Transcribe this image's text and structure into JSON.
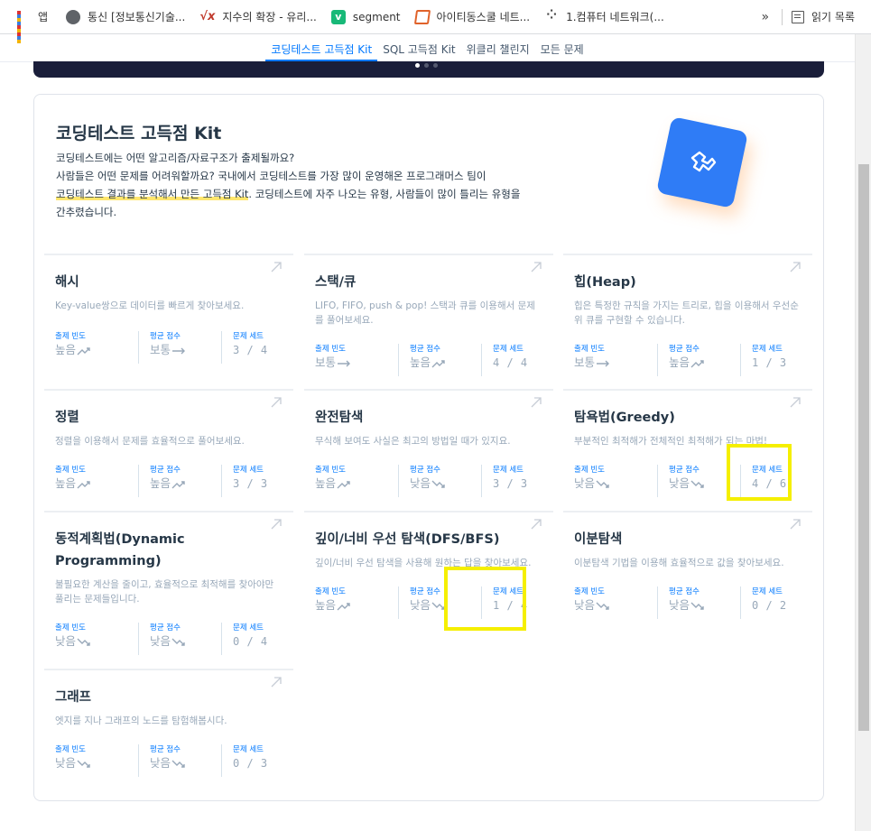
{
  "bookmarks": [
    {
      "label": "앱",
      "icon": "apps-grid-icon"
    },
    {
      "label": "통신 [정보통신기술...",
      "icon": "globe-icon"
    },
    {
      "label": "지수의 확장 - 유리...",
      "icon": "sqrt-icon"
    },
    {
      "label": "segment",
      "icon": "velog-icon"
    },
    {
      "label": "아이티동스쿨 네트...",
      "icon": "m-logo-icon"
    },
    {
      "label": "1.컴퓨터 네트워크(...",
      "icon": "dots-icon"
    }
  ],
  "bookmarks_more": "»",
  "reading_list": "읽기 목록",
  "subnav": [
    {
      "label": "코딩테스트 고득점 Kit",
      "active": true
    },
    {
      "label": "SQL 고득점 Kit",
      "active": false
    },
    {
      "label": "위클리 챌린지",
      "active": false
    },
    {
      "label": "모든 문제",
      "active": false
    }
  ],
  "kit": {
    "title": "코딩테스트 고득점 Kit",
    "desc_line1": "코딩테스트에는 어떤 알고리즘/자료구조가 출제될까요?",
    "desc_line2": "사람들은 어떤 문제를 어려워할까요? 국내에서 코딩테스트를 가장 많이 운영해온 프로그래머스 팀이",
    "desc_highlight": "코딩테스트 결과를 분석해서 만든 고득점 Kit",
    "desc_line3_rest": ". 코딩테스트에 자주 나오는 유형, 사람들이 많이 틀리는 유형을",
    "desc_line4": "간추렸습니다."
  },
  "stat_labels": {
    "freq": "출제 빈도",
    "score": "평균 점수",
    "set": "문제 세트"
  },
  "categories": [
    {
      "name": "해시",
      "desc": "Key-value쌍으로 데이터를 빠르게 찾아보세요.",
      "freq": "높음",
      "freq_trend": "up",
      "score": "보통",
      "score_trend": "flat",
      "set": "3 / 4"
    },
    {
      "name": "스택/큐",
      "desc": "LIFO, FIFO, push & pop! 스택과 큐를 이용해서 문제를 풀어보세요.",
      "freq": "보통",
      "freq_trend": "flat",
      "score": "높음",
      "score_trend": "up",
      "set": "4 / 4"
    },
    {
      "name": "힙(Heap)",
      "desc": "힙은 특정한 규칙을 가지는 트리로, 힙을 이용해서 우선순위 큐를 구현할 수 있습니다.",
      "freq": "보통",
      "freq_trend": "flat",
      "score": "높음",
      "score_trend": "up",
      "set": "1 / 3"
    },
    {
      "name": "정렬",
      "desc": "정렬을 이용해서 문제를 효율적으로 풀어보세요.",
      "freq": "높음",
      "freq_trend": "up",
      "score": "높음",
      "score_trend": "up",
      "set": "3 / 3"
    },
    {
      "name": "완전탐색",
      "desc": "무식해 보여도 사실은 최고의 방법일 때가 있지요.",
      "freq": "높음",
      "freq_trend": "up",
      "score": "낮음",
      "score_trend": "down",
      "set": "3 / 3"
    },
    {
      "name": "탐욕법(Greedy)",
      "desc": "부분적인 최적해가 전체적인 최적해가 되는 마법!",
      "freq": "낮음",
      "freq_trend": "down",
      "score": "낮음",
      "score_trend": "down",
      "set": "4 / 6"
    },
    {
      "name": "동적계획법(Dynamic Programming)",
      "desc": "불필요한 계산을 줄이고, 효율적으로 최적해를 찾아야만 풀리는 문제들입니다.",
      "freq": "낮음",
      "freq_trend": "down",
      "score": "낮음",
      "score_trend": "down",
      "set": "0 / 4"
    },
    {
      "name": "깊이/너비 우선 탐색(DFS/BFS)",
      "desc": "깊이/너비 우선 탐색을 사용해 원하는 답을 찾아보세요.",
      "freq": "높음",
      "freq_trend": "up",
      "score": "낮음",
      "score_trend": "down",
      "set": "1 / 4"
    },
    {
      "name": "이분탐색",
      "desc": "이분탐색 기법을 이용해 효율적으로 값을 찾아보세요.",
      "freq": "낮음",
      "freq_trend": "down",
      "score": "낮음",
      "score_trend": "down",
      "set": "0 / 2"
    },
    {
      "name": "그래프",
      "desc": "엣지를 지나 그래프의 노드를 탐험해봅시다.",
      "freq": "낮음",
      "freq_trend": "down",
      "score": "낮음",
      "score_trend": "down",
      "set": "0 / 3"
    }
  ],
  "colors": {
    "accent": "#0078ff",
    "highlight_box": "#f5ef00",
    "hero": "#1a1e3a"
  }
}
